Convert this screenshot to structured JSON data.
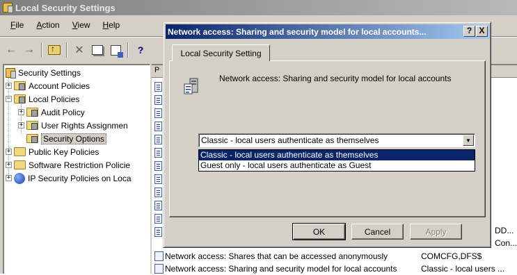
{
  "window": {
    "title": "Local Security Settings"
  },
  "menu": [
    {
      "underline": "F",
      "rest": "ile"
    },
    {
      "underline": "A",
      "rest": "ction"
    },
    {
      "underline": "V",
      "rest": "iew"
    },
    {
      "underline": "H",
      "rest": "elp"
    }
  ],
  "toolbar": {
    "back": "←",
    "forward": "→",
    "delete": "✕"
  },
  "tree": {
    "items": [
      {
        "label": "Security Settings"
      },
      {
        "label": "Account Policies",
        "expander": "+"
      },
      {
        "label": "Local Policies",
        "expander": "−"
      },
      {
        "label": "Audit Policy",
        "expander": "+"
      },
      {
        "label": "User Rights Assignmen",
        "expander": "+"
      },
      {
        "label": "Security Options"
      },
      {
        "label": "Public Key Policies",
        "expander": "+"
      },
      {
        "label": "Software Restriction Policie",
        "expander": "+"
      },
      {
        "label": "IP Security Policies on Loca",
        "expander": "+"
      }
    ]
  },
  "list": {
    "header_first": "P",
    "partial_values": [
      "DD...",
      "Con..."
    ],
    "rows": [
      {
        "name": "Network access: Shares that can be accessed anonymously",
        "value": "COMCFG,DFS$"
      },
      {
        "name": "Network access: Sharing and security model for local accounts",
        "value": "Classic - local users ..."
      }
    ]
  },
  "dialog": {
    "title": "Network access: Sharing and security model for local accounts...",
    "help_btn": "?",
    "close_btn": "X",
    "tab_label": "Local Security Setting",
    "policy_text": "Network access: Sharing and security model for local accounts",
    "combo_value": "Classic - local users authenticate as themselves",
    "options": [
      "Classic - local users authenticate as themselves",
      "Guest only - local users authenticate as Guest"
    ],
    "buttons": {
      "ok": "OK",
      "cancel": "Cancel",
      "apply": "Apply"
    }
  }
}
